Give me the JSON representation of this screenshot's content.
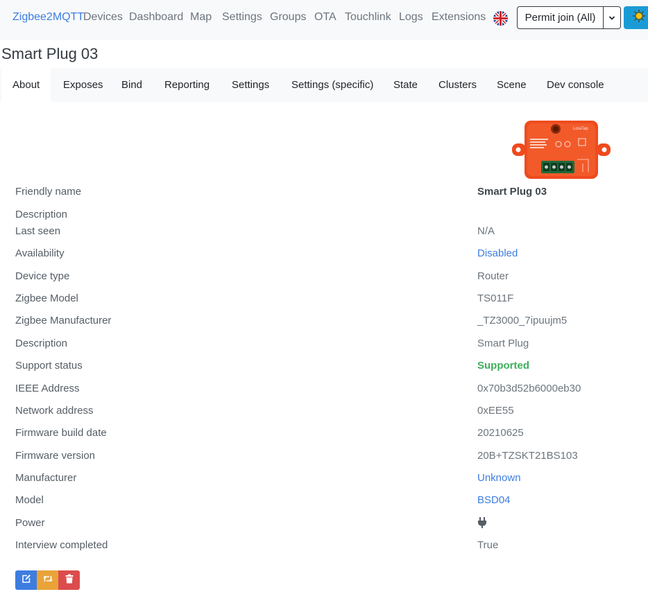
{
  "navbar": {
    "brand": "Zigbee2MQTT",
    "links": [
      "Devices",
      "Dashboard",
      "Map",
      "Settings",
      "Groups",
      "OTA",
      "Touchlink",
      "Logs",
      "Extensions"
    ],
    "language_icon": "uk-flag-icon",
    "permit_join_label": "Permit join (All)",
    "theme_icon": "sun-icon"
  },
  "page": {
    "title": "Smart Plug 03"
  },
  "tabs": [
    "About",
    "Exposes",
    "Bind",
    "Reporting",
    "Settings",
    "Settings (specific)",
    "State",
    "Clusters",
    "Scene",
    "Dev console"
  ],
  "active_tab": "About",
  "device_image": {
    "brand_text": "LoraTap"
  },
  "details": [
    {
      "label": "Friendly name",
      "value": "Smart Plug 03",
      "style": "bold"
    },
    {
      "label": "Description",
      "value": "",
      "style": "muted"
    },
    {
      "label": "Last seen",
      "value": "N/A",
      "style": "muted"
    },
    {
      "label": "Availability",
      "value": "Disabled",
      "style": "link"
    },
    {
      "label": "Device type",
      "value": "Router",
      "style": "muted"
    },
    {
      "label": "Zigbee Model",
      "value": "TS011F",
      "style": "muted"
    },
    {
      "label": "Zigbee Manufacturer",
      "value": "_TZ3000_7ipuujm5",
      "style": "muted"
    },
    {
      "label": "Description",
      "value": "Smart Plug",
      "style": "muted"
    },
    {
      "label": "Support status",
      "value": "Supported",
      "style": "success"
    },
    {
      "label": "IEEE Address",
      "value": "0x70b3d52b6000eb30",
      "style": "muted"
    },
    {
      "label": "Network address",
      "value": "0xEE55",
      "style": "muted"
    },
    {
      "label": "Firmware build date",
      "value": "20210625",
      "style": "muted"
    },
    {
      "label": "Firmware version",
      "value": "20B+TZSKT21BS103",
      "style": "muted"
    },
    {
      "label": "Manufacturer",
      "value": "Unknown",
      "style": "link"
    },
    {
      "label": "Model",
      "value": "BSD04",
      "style": "link"
    },
    {
      "label": "Power",
      "value": "",
      "icon": "plug-icon",
      "style": "muted"
    },
    {
      "label": "Interview completed",
      "value": "True",
      "style": "muted"
    }
  ],
  "actions": [
    {
      "name": "edit",
      "icon": "edit-icon",
      "color": "#3d7de0"
    },
    {
      "name": "reconfigure",
      "icon": "retweet-icon",
      "color": "#e9a338"
    },
    {
      "name": "remove",
      "icon": "trash-icon",
      "color": "#dc4c4c"
    }
  ],
  "colors": {
    "link": "#3d7de0",
    "success": "#3fae5c",
    "nav_bg": "#f8f9fb",
    "theme_button": "#1b9bd6"
  }
}
